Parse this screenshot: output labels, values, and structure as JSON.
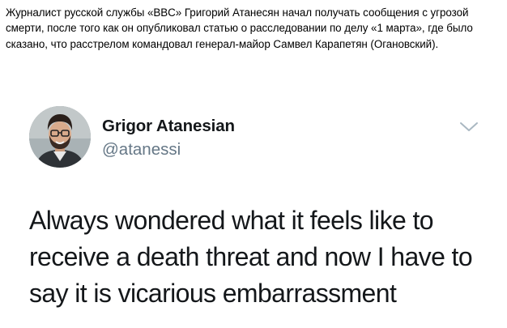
{
  "post": {
    "text": "Журналист русской службы «BBC» Григорий Атанесян начал получать сообщения с угрозой смерти, после того как он опубликовал статью о расследовании по делу «1 марта», где было сказано, что расстрелом командовал генерал-майор Самвел Карапетян (Огановский)."
  },
  "tweet": {
    "author_name": "Grigor Atanesian",
    "author_handle": "@atanessi",
    "lines": [
      "Always wondered what it feels like to",
      "receive a death threat and now I have to",
      "say it is vicarious embarrassment"
    ],
    "menu_icon": "chevron-down-icon"
  },
  "colors": {
    "name": "#14171a",
    "handle": "#657786",
    "chevron": "#aab8c2"
  }
}
